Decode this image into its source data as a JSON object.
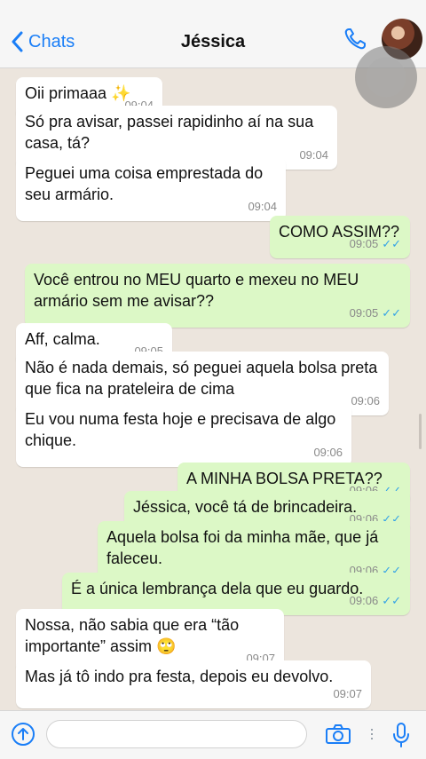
{
  "header": {
    "back_label": "Chats",
    "title": "Jéssica"
  },
  "messages": [
    {
      "dir": "in",
      "text": "Oii primaaa ✨",
      "time": "09:04"
    },
    {
      "dir": "in",
      "text": "Só pra avisar, passei rapidinho aí na sua casa, tá?",
      "time": "09:04"
    },
    {
      "dir": "in",
      "text": "Peguei uma coisa emprestada do seu armário.",
      "time": "09:04"
    },
    {
      "dir": "out",
      "text": "COMO ASSIM??",
      "time": "09:05"
    },
    {
      "dir": "out",
      "text": "Você entrou no MEU quarto e mexeu no MEU armário sem me avisar??",
      "time": "09:05"
    },
    {
      "dir": "in",
      "text": "Aff, calma.",
      "time": "09:05"
    },
    {
      "dir": "in",
      "text": "Não é nada demais, só peguei aquela bolsa preta que fica na prateleira de cima",
      "time": "09:06"
    },
    {
      "dir": "in",
      "text": "Eu vou numa festa hoje e precisava de algo chique.",
      "time": "09:06"
    },
    {
      "dir": "out",
      "text": "A MINHA BOLSA PRETA??",
      "time": "09:06"
    },
    {
      "dir": "out",
      "text": "Jéssica, você tá de brincadeira.",
      "time": "09:06"
    },
    {
      "dir": "out",
      "text": "Aquela bolsa foi da minha mãe, que já faleceu.",
      "time": "09:06"
    },
    {
      "dir": "out",
      "text": "É a única lembrança dela que eu guardo.",
      "time": "09:06"
    },
    {
      "dir": "in",
      "text": "Nossa, não sabia que era “tão importante” assim 🙄",
      "time": "09:07"
    },
    {
      "dir": "in",
      "text": "Mas já tô indo pra festa, depois eu devolvo.",
      "time": "09:07"
    }
  ],
  "read_ticks": "✓✓",
  "footer": {
    "input_placeholder": ""
  }
}
